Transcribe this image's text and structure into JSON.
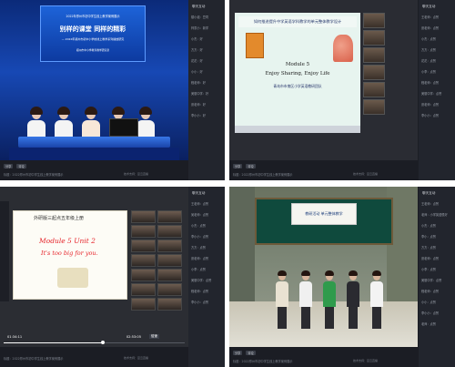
{
  "colors": {
    "panel_bg": "#1b1d24",
    "sidebar_bg": "#22252d",
    "accent_name": "#e0a25a"
  },
  "panels": [
    {
      "screen_line1": "别样的课堂 同样的精彩",
      "screen_line2": "— 2022年郑州市初中小学校线上教学系列播放研究",
      "screen_line3": "郑州市中小学教育教学研究室",
      "sidebar_title": "聊天互动",
      "sidebar_items": [
        "楼小组：豆同",
        "梓童小：新学",
        "小杰：好",
        "方方：好",
        "花花：好",
        "小小：好",
        "程老师：好",
        "美丽中学：好",
        "张老师：好",
        "李小小：好"
      ],
      "controls": {
        "left": "分享",
        "mid": "评论"
      },
      "note": "标题：2022郑州市初中学生线上教学案例展示",
      "footer": "技术支持：豆云直播"
    },
    {
      "slide_band": "如何推进提升中学英语学科教学的单元整体教学设计",
      "slide_title1": "Module 5",
      "slide_title2": "Enjoy Sharing, Enjoy Life",
      "slide_sub": "青岛市市南区小学英语教研团队",
      "sidebar_title": "聊天互动",
      "sidebar_items": [
        "王老师：点赞",
        "张老师：点赞",
        "小杰：点赞",
        "方方：点赞",
        "花花：点赞",
        "小李：点赞",
        "程老师：点赞",
        "美丽中学：点赞",
        "张老师：点赞",
        "李小小：点赞"
      ],
      "controls": {
        "left": "分享",
        "mid": "评论"
      },
      "note": "标题：2022郑州市初中学生线上教学案例展示",
      "footer": "技术支持：豆云直播"
    },
    {
      "slide_title": "外研版三起点五年级上册",
      "slide_line1": "Module 5 Unit 2",
      "slide_line2": "It's too big for you.",
      "time_current": "01:34:11",
      "time_total": "02:53:05",
      "progress": 0.55,
      "speed_label": "倍速",
      "sidebar_title": "聊天互动",
      "sidebar_items": [
        "王老师：点赞",
        "吴老师：点赞",
        "小杰：点赞",
        "李小小：点赞",
        "方方：点赞",
        "张老师：点赞",
        "小李：点赞",
        "美丽中学：点赞",
        "程老师：点赞",
        "李小小：点赞"
      ],
      "note": "标题：2022郑州市初中学生线上教学案例展示",
      "footer": "技术支持：豆云直播"
    },
    {
      "banner_text": "教研活动 单元整体教学",
      "sidebar_title": "聊天互动",
      "sidebar_items": [
        "王老师：点赞",
        "老师：小学英语很好",
        "小杰：点赞",
        "李小：点赞",
        "方方：点赞",
        "张老师：点赞",
        "小李：点赞",
        "美丽中学：点赞",
        "程老师：点赞",
        "小小：点赞",
        "李小小：点赞",
        "老师：点赞"
      ],
      "controls": {
        "left": "分享",
        "mid": "评论"
      },
      "note": "标题：2022郑州市初中学生线上教学案例展示",
      "footer": "技术支持：豆云直播"
    }
  ]
}
